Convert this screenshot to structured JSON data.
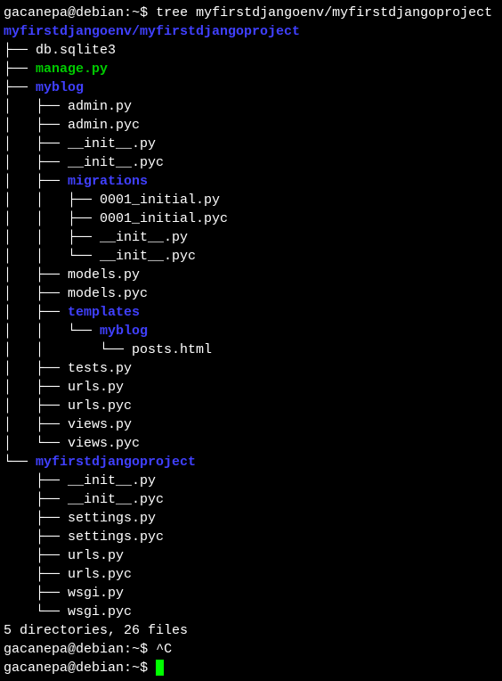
{
  "prompt": {
    "user": "gacanepa",
    "host": "debian",
    "path": "~",
    "symbol": "$"
  },
  "command1": "tree myfirstdjangoenv/myfirstdjangoproject",
  "root_dir": "myfirstdjangoenv/myfirstdjangoproject",
  "tree": {
    "l1_db": "├── ",
    "f_db": "db.sqlite3",
    "l1_manage": "├── ",
    "f_manage": "manage.py",
    "l1_myblog": "├── ",
    "d_myblog": "myblog",
    "l2_admin_py": "│   ├── ",
    "f_admin_py": "admin.py",
    "l2_admin_pyc": "│   ├── ",
    "f_admin_pyc": "admin.pyc",
    "l2_init_py": "│   ├── ",
    "f_init_py": "__init__.py",
    "l2_init_pyc": "│   ├── ",
    "f_init_pyc": "__init__.pyc",
    "l2_migrations": "│   ├── ",
    "d_migrations": "migrations",
    "l3_0001_py": "│   │   ├── ",
    "f_0001_py": "0001_initial.py",
    "l3_0001_pyc": "│   │   ├── ",
    "f_0001_pyc": "0001_initial.pyc",
    "l3_minit_py": "│   │   ├── ",
    "f_minit_py": "__init__.py",
    "l3_minit_pyc": "│   │   └── ",
    "f_minit_pyc": "__init__.pyc",
    "l2_models_py": "│   ├── ",
    "f_models_py": "models.py",
    "l2_models_pyc": "│   ├── ",
    "f_models_pyc": "models.pyc",
    "l2_templates": "│   ├── ",
    "d_templates": "templates",
    "l3_tmyblog": "│   │   └── ",
    "d_tmyblog": "myblog",
    "l4_posts": "│   │       └── ",
    "f_posts": "posts.html",
    "l2_tests_py": "│   ├── ",
    "f_tests_py": "tests.py",
    "l2_urls_py": "│   ├── ",
    "f_urls_py": "urls.py",
    "l2_urls_pyc": "│   ├── ",
    "f_urls_pyc": "urls.pyc",
    "l2_views_py": "│   ├── ",
    "f_views_py": "views.py",
    "l2_views_pyc": "│   └── ",
    "f_views_pyc": "views.pyc",
    "l1_project": "└── ",
    "d_project": "myfirstdjangoproject",
    "l2_pinit_py": "    ├── ",
    "f_pinit_py": "__init__.py",
    "l2_pinit_pyc": "    ├── ",
    "f_pinit_pyc": "__init__.pyc",
    "l2_settings_py": "    ├── ",
    "f_settings_py": "settings.py",
    "l2_settings_pyc": "    ├── ",
    "f_settings_pyc": "settings.pyc",
    "l2_purls_py": "    ├── ",
    "f_purls_py": "urls.py",
    "l2_purls_pyc": "    ├── ",
    "f_purls_pyc": "urls.pyc",
    "l2_wsgi_py": "    ├── ",
    "f_wsgi_py": "wsgi.py",
    "l2_wsgi_pyc": "    └── ",
    "f_wsgi_pyc": "wsgi.pyc"
  },
  "summary_blank": "",
  "summary": "5 directories, 26 files",
  "command2": "^C"
}
